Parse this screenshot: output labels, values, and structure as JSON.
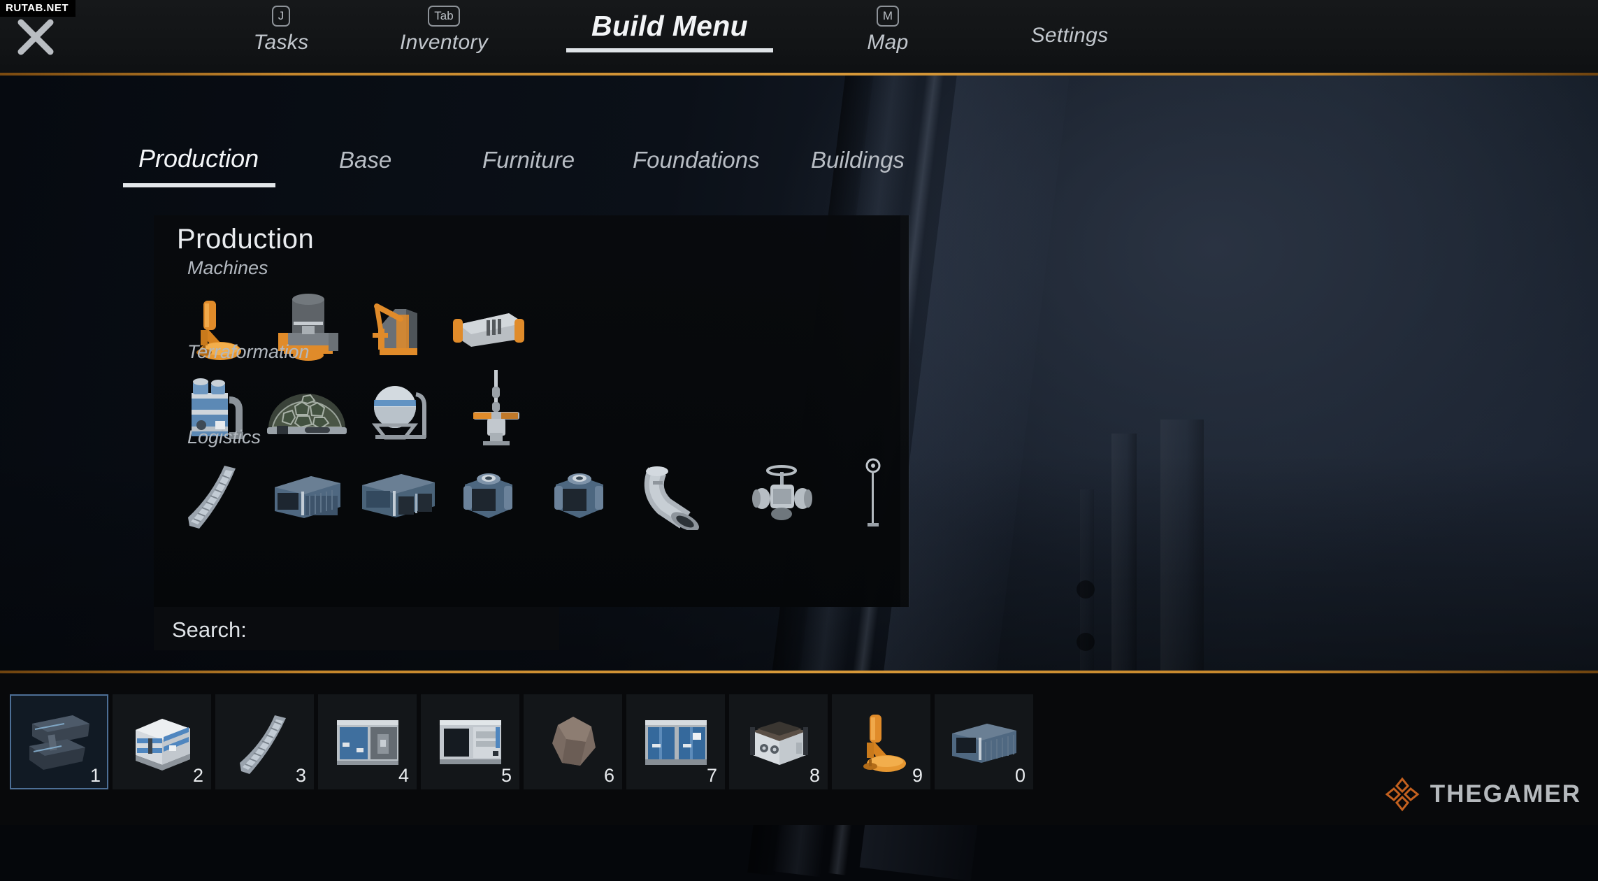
{
  "watermark": {
    "text": "RUTAB.NET"
  },
  "brand": {
    "text": "THEGAMER",
    "logo_icon": "diamond-cluster-icon",
    "accent_color": "#c4611f"
  },
  "topbar": {
    "close_icon": "close-icon",
    "accent_color": "#d89a3a",
    "items": [
      {
        "label": "Tasks",
        "key": "J",
        "active": false,
        "name": "tab-tasks"
      },
      {
        "label": "Inventory",
        "key": "Tab",
        "active": false,
        "name": "tab-inventory"
      },
      {
        "label": "Build Menu",
        "key": "",
        "active": true,
        "name": "tab-build-menu"
      },
      {
        "label": "Map",
        "key": "M",
        "active": false,
        "name": "tab-map"
      },
      {
        "label": "Settings",
        "key": "",
        "active": false,
        "name": "tab-settings"
      }
    ]
  },
  "categories": [
    {
      "label": "Production",
      "active": true
    },
    {
      "label": "Base",
      "active": false
    },
    {
      "label": "Furniture",
      "active": false
    },
    {
      "label": "Foundations",
      "active": false
    },
    {
      "label": "Buildings",
      "active": false
    }
  ],
  "panel": {
    "title": "Production",
    "sections": [
      {
        "label": "Machines",
        "items": [
          "drill-arm-icon",
          "smelter-cylinder-icon",
          "crane-excavator-icon",
          "conveyor-machine-icon"
        ]
      },
      {
        "label": "Terraformation",
        "items": [
          "water-tank-icon",
          "biodome-icon",
          "sphere-tank-icon",
          "antenna-tower-icon"
        ]
      },
      {
        "label": "Logistics",
        "items": [
          "conveyor-belt-icon",
          "small-container-icon",
          "large-container-icon",
          "storage-cube-icon",
          "storage-cube-icon",
          "pipe-elbow-icon",
          "valve-icon",
          "pole-marker-icon"
        ]
      }
    ]
  },
  "search": {
    "label": "Search:",
    "value": "",
    "placeholder": ""
  },
  "scrollbar": {
    "position_percent": 2
  },
  "hotbar": {
    "selected_slot": "1",
    "slots": [
      {
        "key": "1",
        "item_icon": "jetpack-icon",
        "selected": true
      },
      {
        "key": "2",
        "item_icon": "white-crate-icon",
        "selected": false
      },
      {
        "key": "3",
        "item_icon": "conveyor-belt-icon",
        "selected": false
      },
      {
        "key": "4",
        "item_icon": "wall-panel-blue-icon",
        "selected": false
      },
      {
        "key": "5",
        "item_icon": "wall-panel-window-icon",
        "selected": false
      },
      {
        "key": "6",
        "item_icon": "ore-rock-icon",
        "selected": false
      },
      {
        "key": "7",
        "item_icon": "blue-doors-icon",
        "selected": false
      },
      {
        "key": "8",
        "item_icon": "white-bin-icon",
        "selected": false
      },
      {
        "key": "9",
        "item_icon": "drill-arm-icon",
        "selected": false
      },
      {
        "key": "0",
        "item_icon": "blue-container-icon",
        "selected": false
      }
    ]
  }
}
